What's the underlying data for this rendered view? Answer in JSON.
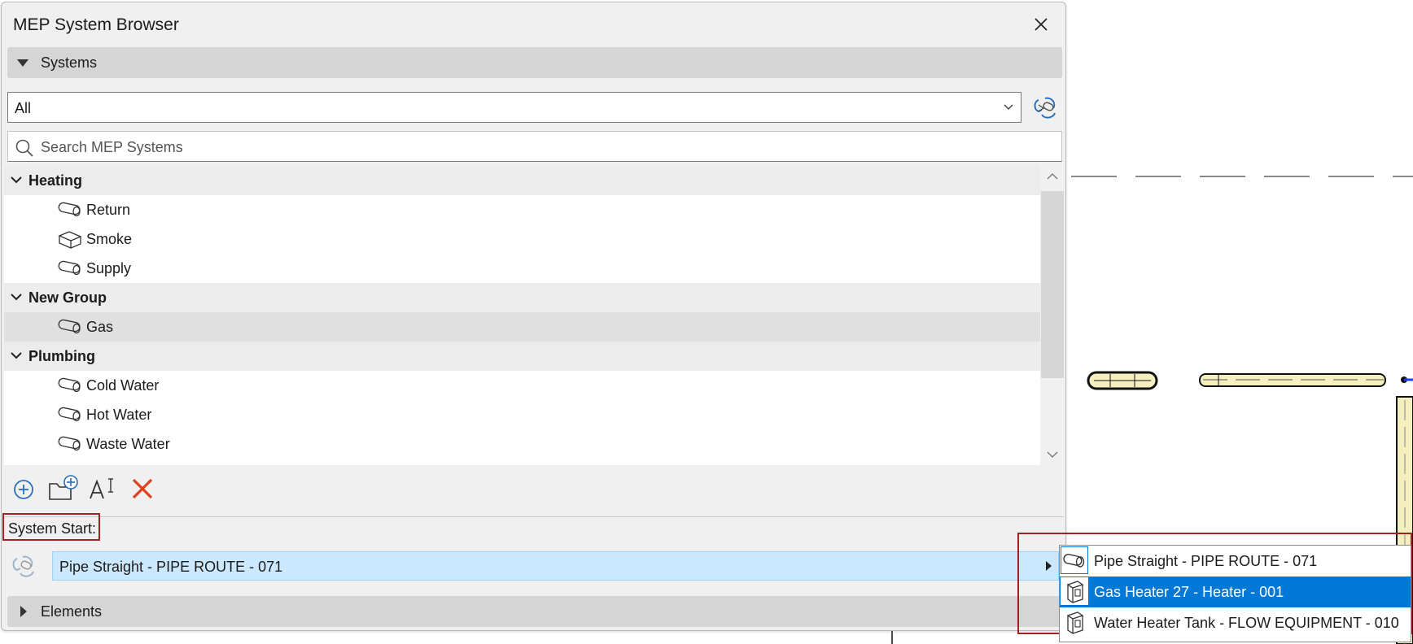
{
  "window": {
    "title": "MEP System Browser"
  },
  "systems_section": {
    "label": "Systems"
  },
  "filter_select": {
    "value": "All"
  },
  "search": {
    "placeholder": "Search MEP Systems"
  },
  "tree": {
    "groups": [
      {
        "name": "Heating",
        "items": [
          {
            "name": "Return",
            "icon": "pipe-system-icon"
          },
          {
            "name": "Smoke",
            "icon": "duct-system-icon"
          },
          {
            "name": "Supply",
            "icon": "pipe-system-icon"
          }
        ]
      },
      {
        "name": "New Group",
        "items": [
          {
            "name": "Gas",
            "icon": "pipe-system-icon",
            "selected": true
          }
        ]
      },
      {
        "name": "Plumbing",
        "items": [
          {
            "name": "Cold Water",
            "icon": "pipe-system-icon"
          },
          {
            "name": "Hot Water",
            "icon": "pipe-system-icon"
          },
          {
            "name": "Waste Water",
            "icon": "pipe-system-icon"
          }
        ]
      }
    ]
  },
  "toolbar": {
    "buttons": [
      "add-system-icon",
      "add-group-icon",
      "rename-icon",
      "delete-icon"
    ]
  },
  "system_start": {
    "label": "System Start:",
    "value": "Pipe Straight - PIPE ROUTE - 071"
  },
  "start_options": [
    {
      "label": "Pipe Straight - PIPE ROUTE - 071",
      "icon": "pipe-icon"
    },
    {
      "label": "Gas Heater 27 - Heater - 001",
      "icon": "equipment-icon",
      "highlighted": true
    },
    {
      "label": "Water Heater Tank - FLOW EQUIPMENT - 010",
      "icon": "equipment-icon"
    }
  ],
  "elements_section": {
    "label": "Elements"
  },
  "colors": {
    "accent": "#0078d7",
    "selection_field": "#cce8ff",
    "highlight_border": "#a02323",
    "delete_red": "#e0401c",
    "pipe_fill": "#f5efbf"
  }
}
